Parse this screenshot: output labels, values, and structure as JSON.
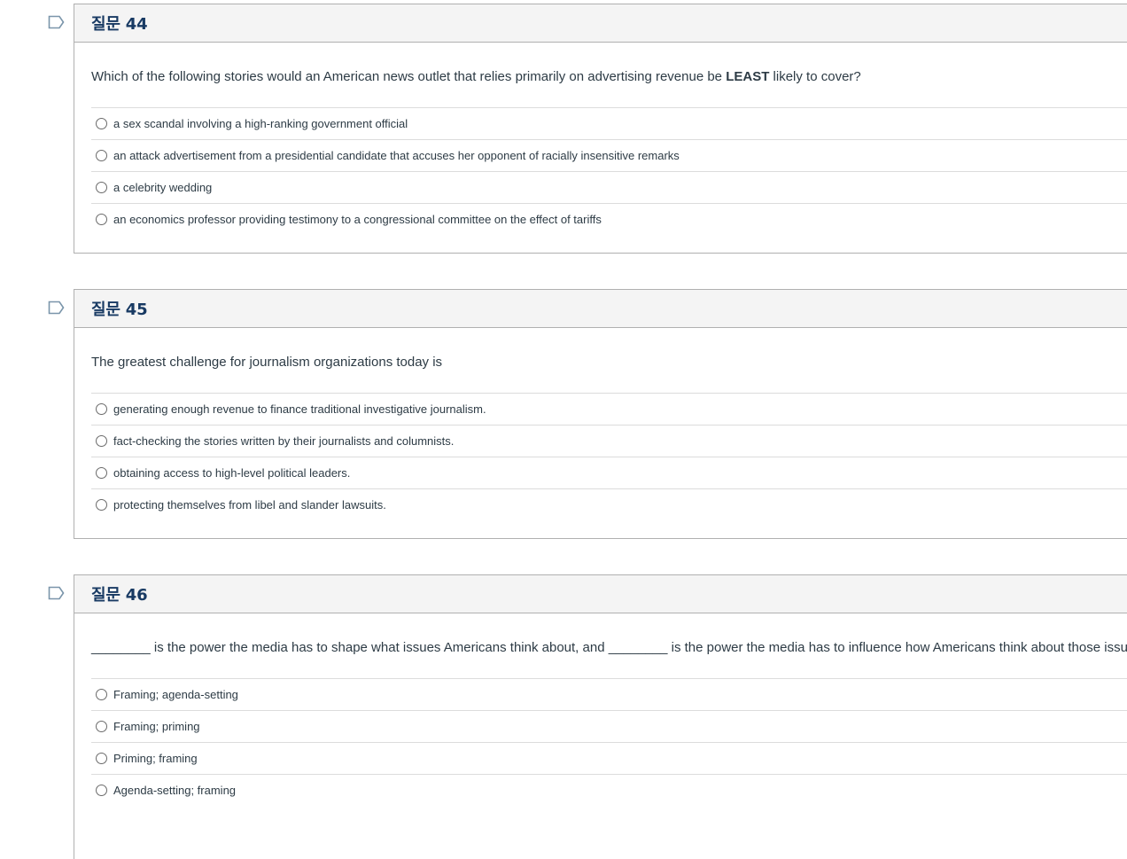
{
  "questions": [
    {
      "title": "질문 44",
      "text_before": "Which of the following stories would an American news outlet that relies primarily on advertising revenue be ",
      "text_bold": "LEAST",
      "text_after": " likely to cover?",
      "answers": [
        "a sex scandal involving a high-ranking government official",
        "an attack advertisement from a presidential candidate that accuses her opponent of racially insensitive remarks",
        "a celebrity wedding",
        "an economics professor providing testimony to a congressional committee on the effect of tariffs"
      ]
    },
    {
      "title": "질문 45",
      "text_before": "The greatest challenge for journalism organizations today is",
      "text_bold": "",
      "text_after": "",
      "answers": [
        "generating enough revenue to finance traditional investigative journalism.",
        "fact-checking the stories written by their journalists and columnists.",
        "obtaining access to high-level political leaders.",
        "protecting themselves from libel and slander lawsuits."
      ]
    },
    {
      "title": "질문 46",
      "text_before": "________ is the power the media has to shape what issues Americans think about, and ________ is the power the media has to influence how Americans think about those issues.",
      "text_bold": "",
      "text_after": "",
      "answers": [
        "Framing; agenda-setting",
        "Framing; priming",
        "Priming; framing",
        "Agenda-setting; framing"
      ]
    }
  ],
  "icons": {
    "flag": "flag-outline-icon",
    "radio": "radio-unchecked"
  },
  "colors": {
    "title": "#183a63",
    "text": "#2d3b45",
    "header_bg": "#f4f4f4",
    "border": "#b0b0b0",
    "flag": "#7a95aa"
  }
}
